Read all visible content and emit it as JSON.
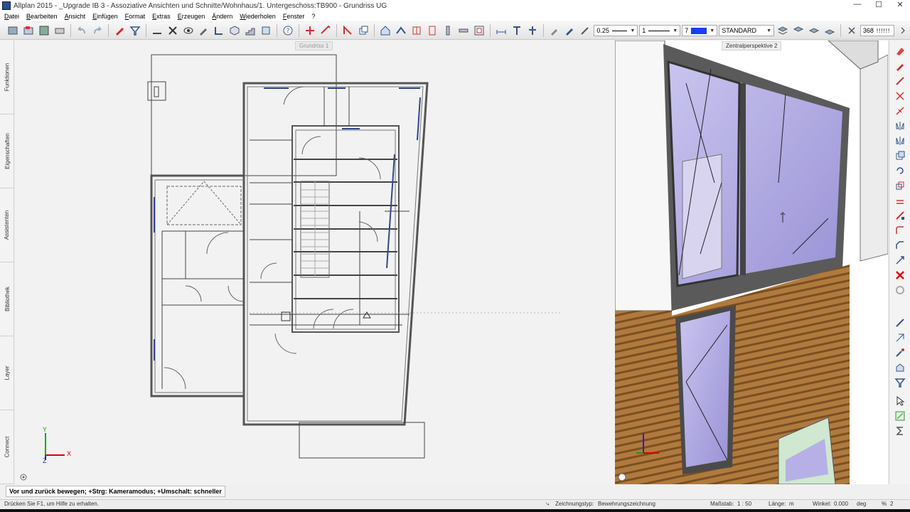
{
  "titlebar": {
    "title": "Allplan 2015 - _Upgrade IB 3 - Assoziative Ansichten und Schnitte/Wohnhaus/1. Untergeschoss:TB900 - Grundriss UG",
    "minimize": "—",
    "maximize": "☐",
    "close": "✕"
  },
  "menu": [
    "Datei",
    "Bearbeiten",
    "Ansicht",
    "Einfügen",
    "Format",
    "Extras",
    "Erzeugen",
    "Ändern",
    "Wiederholen",
    "Fenster",
    "?"
  ],
  "toolbar": {
    "pen_thickness": "0.25",
    "line_type": "1",
    "color_index": "7",
    "layer": "STANDARD",
    "scale_value": "368"
  },
  "left_tabs": [
    "Funktionen",
    "Eigenschaften",
    "Assistenten",
    "Bibliothek",
    "Layer",
    "Connect"
  ],
  "views": {
    "plan_label": "Grundriss 1",
    "persp_label": "Zentralperspektive 2"
  },
  "axes": {
    "x": "X",
    "y": "Y",
    "z": "Z"
  },
  "hint": "Vor und zurück bewegen; +Strg: Kameramodus; +Umschalt: schneller",
  "status": {
    "help": "Drücken Sie F1, um Hilfe zu erhalten.",
    "drawing_type_label": "Zeichnungstyp:",
    "drawing_type": "Bewehrungszeichnung",
    "scale_label": "Maßstab:",
    "scale": "1 : 50",
    "length_label": "Länge:",
    "length_unit": "m",
    "angle_label": "Winkel:",
    "angle": "0.000",
    "angle_unit": "deg",
    "percent_label": "%",
    "percent": "2"
  },
  "colors": {
    "accent_blue": "#1a3cff",
    "glass": "#b6b0e6",
    "wood": "#b07a3e",
    "frame": "#4a4a4a"
  }
}
